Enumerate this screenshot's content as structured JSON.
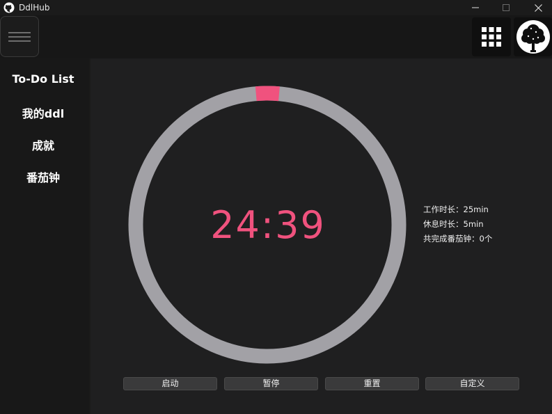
{
  "window": {
    "title": "DdlHub",
    "app_icon": "github-icon",
    "controls": [
      "minimize-icon",
      "maximize-icon",
      "close-icon"
    ]
  },
  "header": {
    "menu_icon": "hamburger-menu-icon",
    "apps_icon": "grid-apps-icon",
    "avatar_icon": "tree-avatar-icon"
  },
  "sidebar": {
    "items": [
      {
        "label": "To-Do List"
      },
      {
        "label": "我的ddl"
      },
      {
        "label": "成就"
      },
      {
        "label": "番茄钟"
      }
    ]
  },
  "timer": {
    "display": "24:39",
    "remaining_seconds": 1479,
    "total_seconds": 1500,
    "elapsed_fraction": 0.014,
    "colors": {
      "track": "#a2a1a6",
      "progress": "#f0527e",
      "text": "#f0527e"
    }
  },
  "info": {
    "work_duration": "工作时长：25min",
    "break_duration": "休息时长：5min",
    "completed": "共完成番茄钟：0个"
  },
  "controls": {
    "start": "启动",
    "pause": "暂停",
    "reset": "重置",
    "custom": "自定义"
  }
}
